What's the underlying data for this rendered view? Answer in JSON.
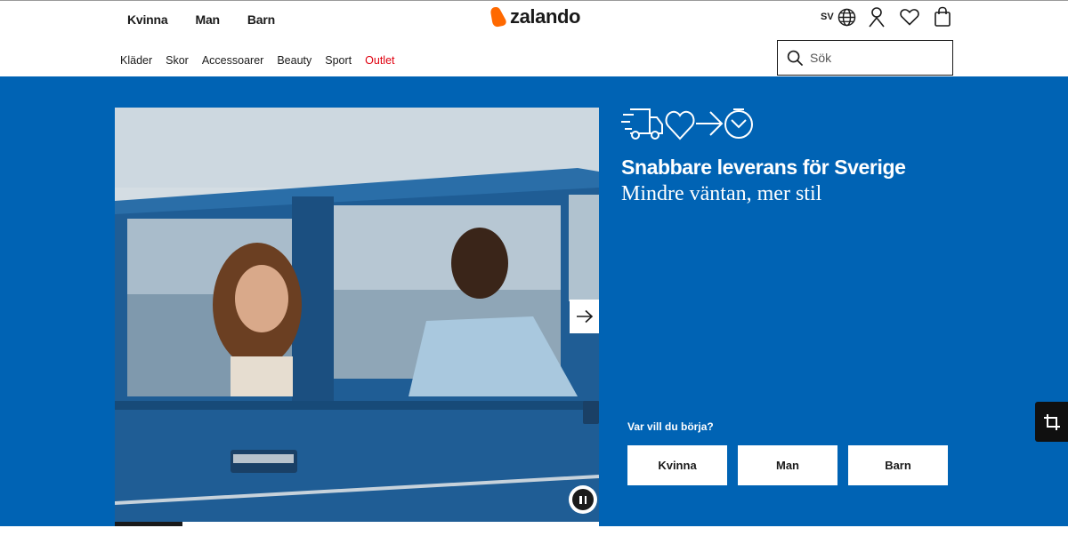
{
  "header": {
    "gender_nav": [
      "Kvinna",
      "Man",
      "Barn"
    ],
    "logo_text": "zalando",
    "language": "SV",
    "category_nav": [
      {
        "label": "Kläder",
        "highlight": false
      },
      {
        "label": "Skor",
        "highlight": false
      },
      {
        "label": "Accessoarer",
        "highlight": false
      },
      {
        "label": "Beauty",
        "highlight": false
      },
      {
        "label": "Sport",
        "highlight": false
      },
      {
        "label": "Outlet",
        "highlight": true
      }
    ],
    "search": {
      "placeholder": "Sök",
      "value": ""
    },
    "icons": [
      "globe-icon",
      "user-icon",
      "heart-icon",
      "bag-icon"
    ]
  },
  "hero": {
    "background_color": "#0063b4",
    "promo_icons": [
      "delivery-truck-icon",
      "heart-icon",
      "arrow-right-icon",
      "clock-icon"
    ],
    "title": "Snabbare leverans för Sverige",
    "subtitle": "Mindre väntan, mer stil",
    "start_question": "Var vill du börja?",
    "start_buttons": [
      "Kvinna",
      "Man",
      "Barn"
    ],
    "carousel": {
      "progress": 0.14,
      "controls": [
        "next-arrow-icon",
        "pause-icon"
      ]
    }
  },
  "colors": {
    "brand_orange": "#ff6900",
    "outlet_red": "#e0000f",
    "hero_blue": "#0063b4"
  },
  "side_tool": {
    "icon": "crop-icon"
  }
}
